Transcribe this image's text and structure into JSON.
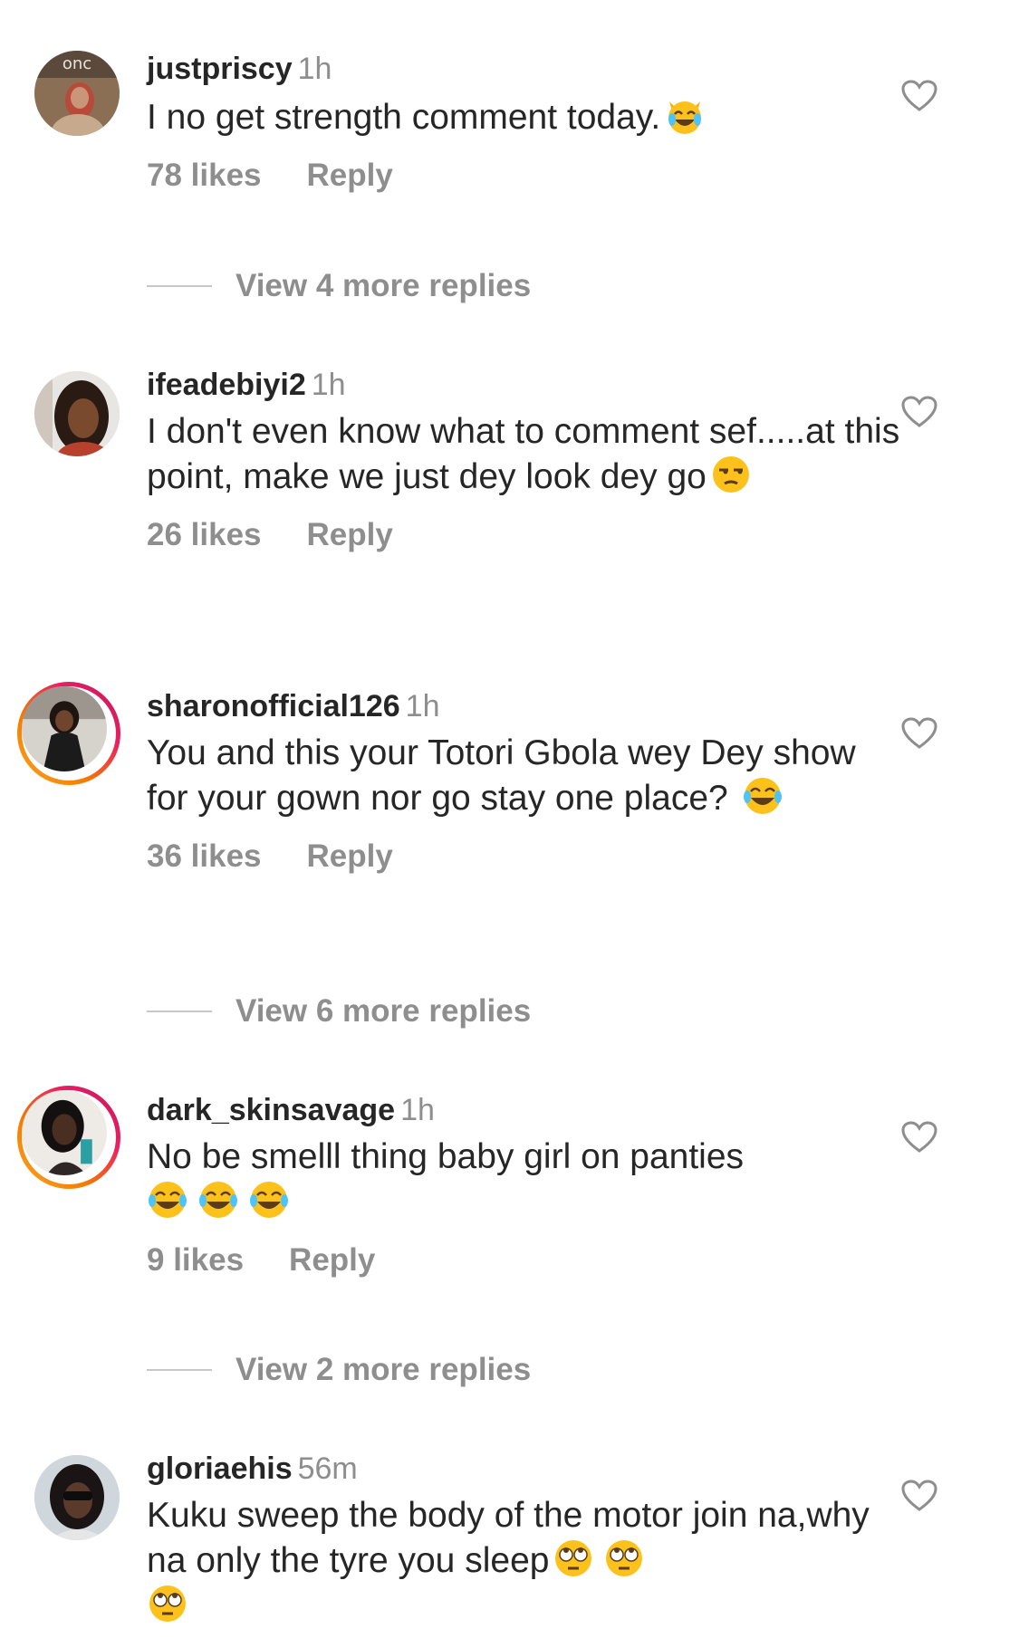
{
  "comments": [
    {
      "username": "justpriscy",
      "time": "1h",
      "text": "I no get strength comment today.",
      "emojis": [
        "joy-cat"
      ],
      "likes": "78 likes",
      "reply": "Reply",
      "story_ring": false
    },
    {
      "username": "ifeadebiyi2",
      "time": "1h",
      "text": "I don't even know what to comment sef.....at this point, make we just dey look dey go",
      "emojis": [
        "unamused"
      ],
      "likes": "26 likes",
      "reply": "Reply",
      "story_ring": false
    },
    {
      "username": "sharonofficial126",
      "time": "1h",
      "text": "You and this your Totori Gbola wey Dey show for your gown nor go stay one place?",
      "emojis": [
        "joy"
      ],
      "likes": "36 likes",
      "reply": "Reply",
      "story_ring": true
    },
    {
      "username": "dark_skinsavage",
      "time": "1h",
      "text": "No be smelll thing baby girl on panties",
      "emojis": [
        "joy",
        "joy",
        "joy"
      ],
      "likes": "9 likes",
      "reply": "Reply",
      "story_ring": true
    },
    {
      "username": "gloriaehis",
      "time": "56m",
      "text": "Kuku sweep the body of the motor join na,why na only the tyre you sleep",
      "emojis": [
        "eye-roll",
        "eye-roll",
        "eye-roll"
      ],
      "likes": "",
      "reply": "",
      "story_ring": false
    }
  ],
  "view_more": [
    "View 4 more replies",
    "View 6 more replies",
    "View 2 more replies"
  ],
  "colors": {
    "username": "#262626",
    "secondary": "#8e8e8e",
    "divider": "#c7c7c7",
    "story_ring_start": "#f9a825",
    "story_ring_end": "#c2185b"
  },
  "icons": {
    "like": "heart-outline-icon"
  }
}
